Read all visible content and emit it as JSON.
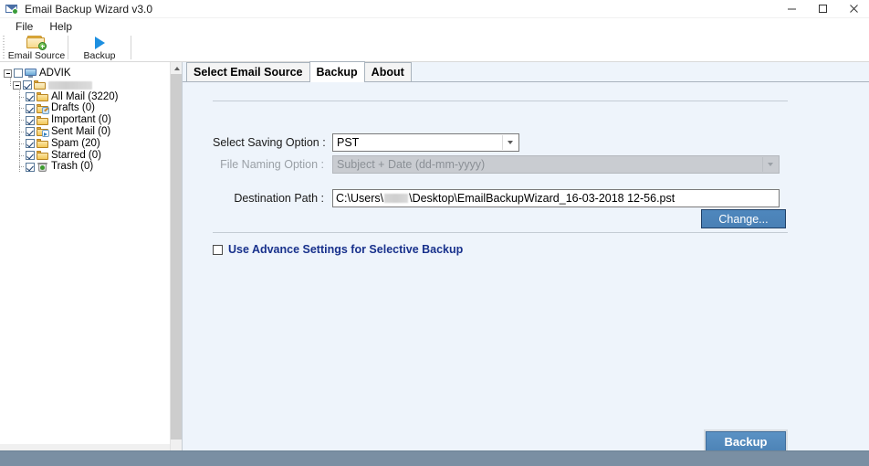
{
  "window": {
    "title": "Email Backup Wizard v3.0",
    "icon": "email-app-icon",
    "minimize": "–",
    "maximize": "❐",
    "close": "✕"
  },
  "menubar": {
    "items": [
      {
        "label": "File"
      },
      {
        "label": "Help"
      }
    ]
  },
  "toolbar": {
    "buttons": [
      {
        "label": "Email Source",
        "icon": "folder-add-icon"
      },
      {
        "label": "Backup",
        "icon": "play-icon"
      }
    ]
  },
  "tree": {
    "root": {
      "label": "ADVIK",
      "icon": "monitor-icon",
      "checked": false,
      "expanded": true
    },
    "account": {
      "label": "",
      "redacted": true,
      "icon": "open-folder-icon",
      "checked": true,
      "expanded": true
    },
    "folders": [
      {
        "label": "All Mail (3220)",
        "icon": "folder-icon",
        "checked": true
      },
      {
        "label": "Drafts (0)",
        "icon": "folder-drafts-icon",
        "checked": true
      },
      {
        "label": "Important (0)",
        "icon": "folder-icon",
        "checked": true
      },
      {
        "label": "Sent Mail (0)",
        "icon": "folder-sent-icon",
        "checked": true
      },
      {
        "label": "Spam (20)",
        "icon": "folder-icon",
        "checked": true
      },
      {
        "label": "Starred (0)",
        "icon": "folder-icon",
        "checked": true
      },
      {
        "label": "Trash (0)",
        "icon": "trash-icon",
        "checked": true
      }
    ]
  },
  "scrollbar": {
    "up_arrow": "▲"
  },
  "tabs": [
    {
      "label": "Select Email Source",
      "active": false
    },
    {
      "label": "Backup",
      "active": true
    },
    {
      "label": "About",
      "active": false
    }
  ],
  "form": {
    "saving_option": {
      "label": "Select Saving Option :",
      "value": "PST",
      "enabled": true
    },
    "file_naming_option": {
      "label": "File Naming Option :",
      "value": "Subject + Date (dd-mm-yyyy)",
      "enabled": false
    },
    "destination_path": {
      "label": "Destination Path :",
      "value_prefix": "C:\\Users\\",
      "value_suffix": "\\Desktop\\EmailBackupWizard_16-03-2018 12-56.pst",
      "redacted_user": true
    },
    "change_button": {
      "label": "Change..."
    },
    "advance_settings": {
      "label": "Use Advance Settings for Selective Backup",
      "checked": false
    },
    "backup_button": {
      "label": "Backup"
    }
  },
  "colors": {
    "panel_bg": "#eef4fb",
    "accent_blue": "#4e87bd",
    "link_blue": "#18318c",
    "statusbar": "#7a8fa3",
    "disabled_gray": "#c9ccd1"
  }
}
